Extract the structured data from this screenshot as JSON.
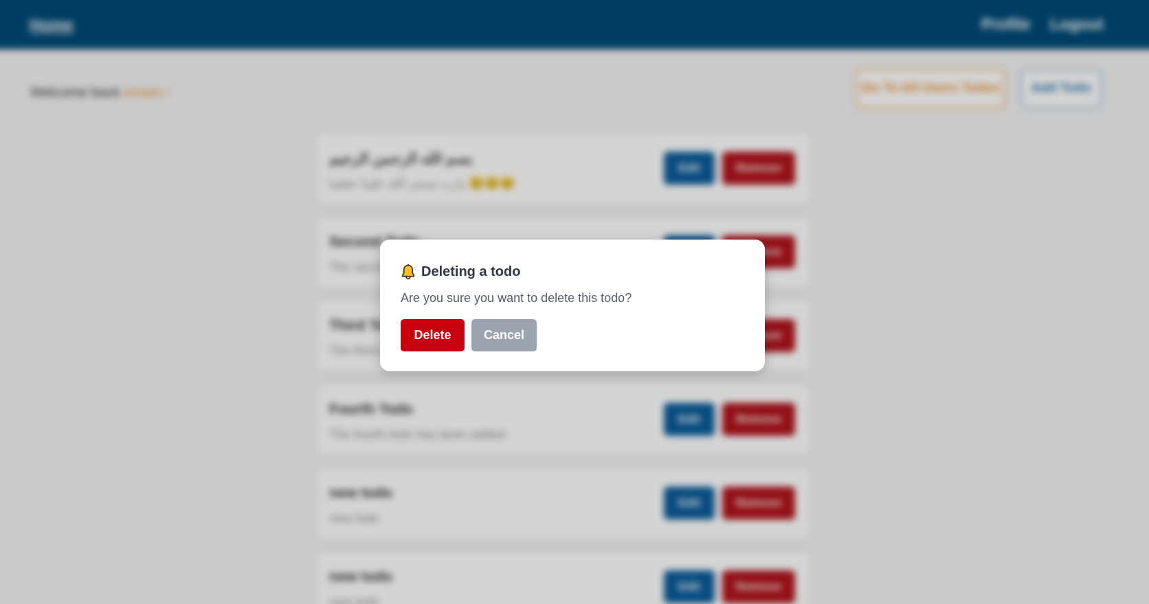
{
  "navbar": {
    "home_label": "Home",
    "profile_label": "Profile",
    "logout_label": "Logout",
    "background_color": "#014a76"
  },
  "header": {
    "welcome_prefix": "Welcome back ",
    "username": "emam",
    "welcome_suffix": " !",
    "all_users_button": "Go To All Users Todos",
    "add_todo_button": "Add Todo"
  },
  "todos": [
    {
      "title": "بسم الله الرحمن الرحيم",
      "description": "يارب مستر الله علينا عطينا 😊😊😊"
    },
    {
      "title": "Second Todo",
      "description": "The second todo has been added"
    },
    {
      "title": "Third Todo",
      "description": "The third todo has been added"
    },
    {
      "title": "Fourth Todo",
      "description": "The fourth todo has been added"
    },
    {
      "title": "new todo",
      "description": "new todo"
    },
    {
      "title": "new todo",
      "description": "new todo"
    }
  ],
  "todo_actions": {
    "edit_label": "Edit",
    "remove_label": "Remove"
  },
  "modal": {
    "icon": "bell-icon",
    "title": "Deleting a todo",
    "message": "Are you sure you want to delete this todo?",
    "delete_label": "Delete",
    "cancel_label": "Cancel",
    "delete_color": "#c8000d",
    "cancel_color": "#9ba3ae"
  }
}
